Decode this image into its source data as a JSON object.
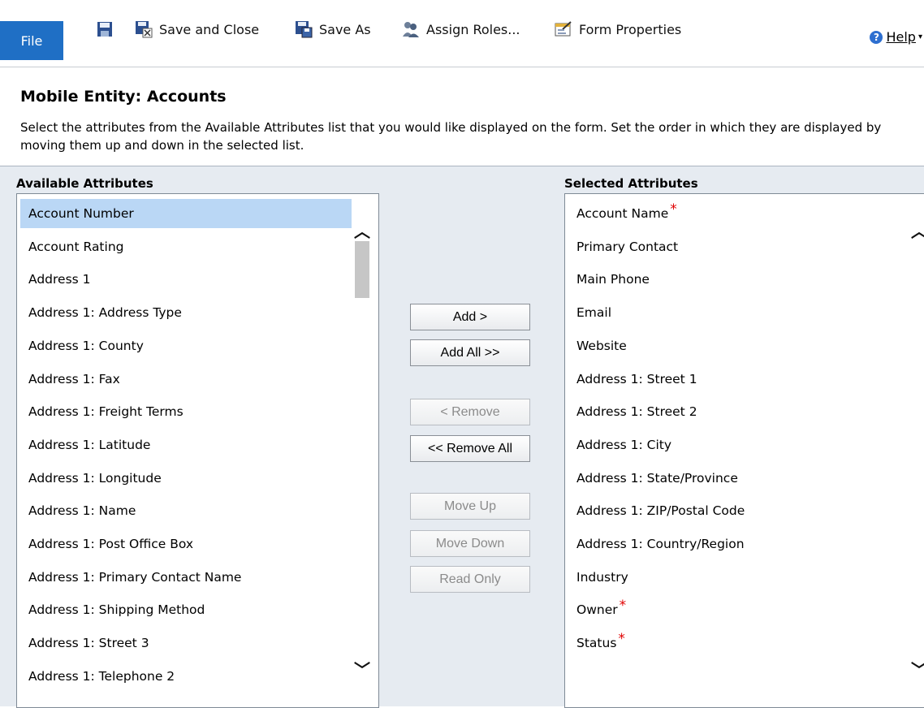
{
  "toolbar": {
    "file_label": "File",
    "save_and_close_label": "Save and Close",
    "save_as_label": "Save As",
    "assign_roles_label": "Assign Roles...",
    "form_properties_label": "Form Properties",
    "help_label": "Help"
  },
  "header": {
    "title": "Mobile Entity: Accounts",
    "description": "Select the attributes from the Available Attributes list that you would like displayed on the form. Set the order in which they are displayed by moving them up and down in the selected list."
  },
  "available": {
    "heading": "Available Attributes",
    "items": [
      "Account Number",
      "Account Rating",
      "Address 1",
      "Address 1: Address Type",
      "Address 1: County",
      "Address 1: Fax",
      "Address 1: Freight Terms",
      "Address 1: Latitude",
      "Address 1: Longitude",
      "Address 1: Name",
      "Address 1: Post Office Box",
      "Address 1: Primary Contact Name",
      "Address 1: Shipping Method",
      "Address 1: Street 3",
      "Address 1: Telephone 2"
    ],
    "selected_item": "Account Number"
  },
  "selected": {
    "heading": "Selected Attributes",
    "items": [
      {
        "label": "Account Name",
        "required": "*"
      },
      {
        "label": "Primary Contact",
        "required": ""
      },
      {
        "label": "Main Phone",
        "required": ""
      },
      {
        "label": "Email",
        "required": ""
      },
      {
        "label": "Website",
        "required": ""
      },
      {
        "label": "Address 1: Street 1",
        "required": ""
      },
      {
        "label": "Address 1: Street 2",
        "required": ""
      },
      {
        "label": "Address 1: City",
        "required": ""
      },
      {
        "label": "Address 1: State/Province",
        "required": ""
      },
      {
        "label": "Address 1: ZIP/Postal Code",
        "required": ""
      },
      {
        "label": "Address 1: Country/Region",
        "required": ""
      },
      {
        "label": "Industry",
        "required": ""
      },
      {
        "label": "Owner",
        "required": "*"
      },
      {
        "label": "Status",
        "required": "*"
      }
    ]
  },
  "buttons": {
    "add": "Add >",
    "add_all": "Add All >>",
    "remove": "< Remove",
    "remove_all": "<< Remove All",
    "move_up": "Move Up",
    "move_down": "Move Down",
    "read_only": "Read Only"
  },
  "colors": {
    "file_tab": "#1f6fc5",
    "selection": "#bad7f5",
    "panel_background": "#e6ebf1",
    "required_marker": "#e00000"
  }
}
